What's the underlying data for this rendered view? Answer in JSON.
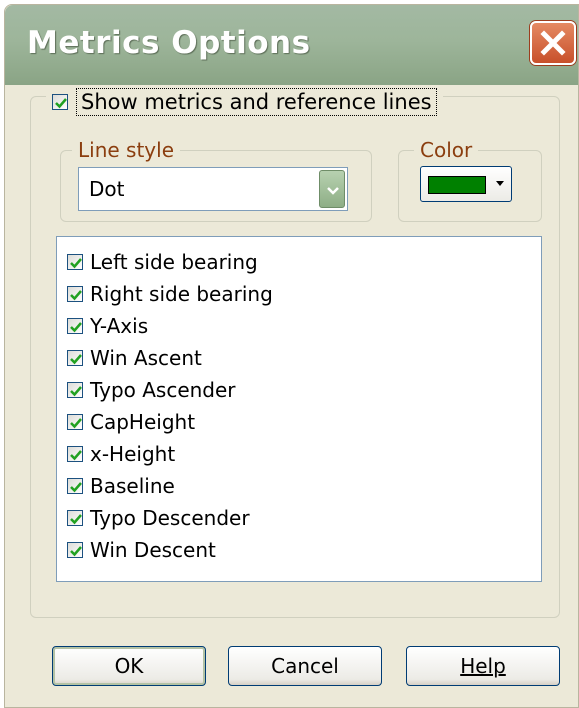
{
  "window": {
    "title": "Metrics Options",
    "close_icon": "close-icon"
  },
  "main_group": {
    "show_label": "Show metrics and reference lines",
    "show_checked": true
  },
  "line_style": {
    "legend": "Line style",
    "value": "Dot"
  },
  "color": {
    "legend": "Color",
    "value": "#008000"
  },
  "metrics": [
    {
      "label": "Left side bearing",
      "checked": true
    },
    {
      "label": "Right side bearing",
      "checked": true
    },
    {
      "label": "Y-Axis",
      "checked": true
    },
    {
      "label": "Win Ascent",
      "checked": true
    },
    {
      "label": "Typo Ascender",
      "checked": true
    },
    {
      "label": "CapHeight",
      "checked": true
    },
    {
      "label": "x-Height",
      "checked": true
    },
    {
      "label": "Baseline",
      "checked": true
    },
    {
      "label": "Typo Descender",
      "checked": true
    },
    {
      "label": "Win Descent",
      "checked": true
    }
  ],
  "buttons": {
    "ok": "OK",
    "cancel": "Cancel",
    "help": "Help"
  }
}
